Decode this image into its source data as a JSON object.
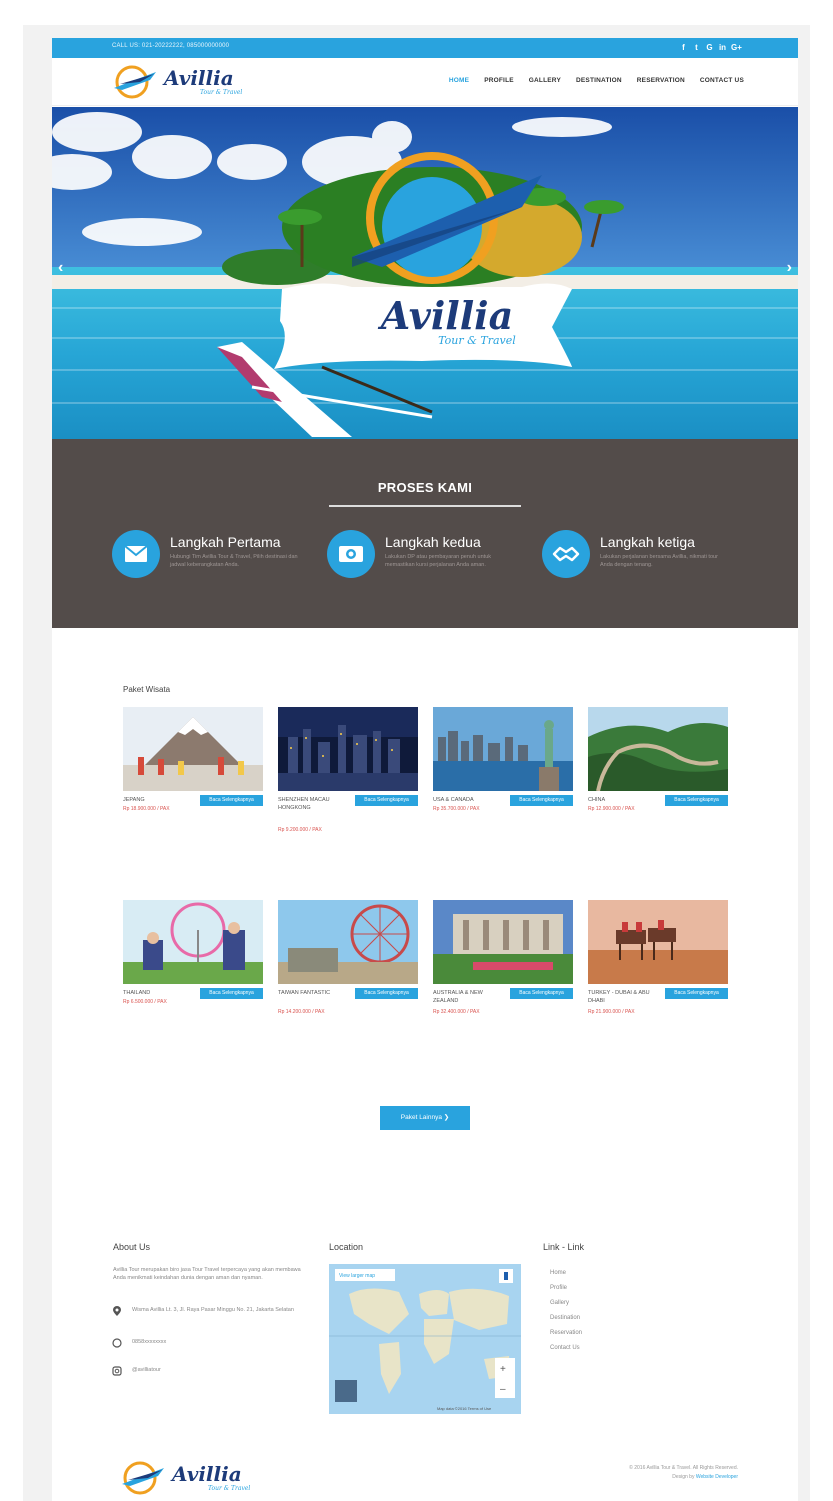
{
  "topbar": {
    "phone": "CALL US: 021-20222222, 085000000000",
    "social": [
      "f",
      "t",
      "G",
      "in",
      "G+"
    ]
  },
  "brand": {
    "name": "Avillia",
    "tagline": "Tour & Travel"
  },
  "nav": [
    "HOME",
    "PROFILE",
    "GALLERY",
    "DESTINATION",
    "RESERVATION",
    "CONTACT US"
  ],
  "hero": {
    "prev": "‹",
    "next": "›"
  },
  "process": {
    "title": "PROSES KAMI",
    "steps": [
      {
        "title": "Langkah Pertama",
        "desc": "Hubungi Tim Avillia Tour & Travel, Pilih destinasi dan jadwal keberangkatan Anda."
      },
      {
        "title": "Langkah kedua",
        "desc": "Lakukan DP atau pembayaran penuh untuk memastikan kursi perjalanan Anda aman."
      },
      {
        "title": "Langkah ketiga",
        "desc": "Lakukan perjalanan bersama Avillia, nikmati tour Anda dengan tenang."
      }
    ]
  },
  "paket": {
    "title": "Paket Wisata",
    "button": "Baca Selengkapnya",
    "items": [
      {
        "name": "JEPANG",
        "price": "Rp 18.900.000 / PAX"
      },
      {
        "name": "SHENZHEN MACAU HONGKONG",
        "price": "Rp 9.200.000 / PAX"
      },
      {
        "name": "USA & CANADA",
        "price": "Rp 35.700.000 / PAX"
      },
      {
        "name": "CHINA",
        "price": "Rp 12.900.000 / PAX"
      },
      {
        "name": "THAILAND",
        "price": "Rp 6.500.000 / PAX"
      },
      {
        "name": "TAIWAN FANTASTIC",
        "price": "Rp 14.200.000 / PAX"
      },
      {
        "name": "AUSTRALIA & NEW ZEALAND",
        "price": "Rp 32.400.000 / PAX"
      },
      {
        "name": "TURKEY - DUBAI & ABU DHABI",
        "price": "Rp 21.900.000 / PAX"
      }
    ],
    "more": "Paket Lainnya"
  },
  "footer": {
    "about_title": "About Us",
    "about_text": "Avillia Tour merupakan biro jasa Tour Travel terpercaya yang akan membawa Anda menikmati keindahan dunia dengan aman dan nyaman.",
    "address": "Wisma Avillia Lt. 3, Jl. Raya Pasar Minggu No. 21, Jakarta Selatan",
    "whatsapp": "0858xxxxxxxx",
    "instagram": "@avilliatour",
    "location_title": "Location",
    "map_button": "View larger map",
    "map_credit": "Map data ©2016 Terms of Use",
    "links_title": "Link - Link",
    "links": [
      "Home",
      "Profile",
      "Gallery",
      "Destination",
      "Reservation",
      "Contact Us"
    ],
    "copyright": "© 2016 Avillia Tour & Travel. All Rights Reserved.",
    "designed_prefix": "Design by",
    "designed_by": "Website Developer"
  },
  "colors": {
    "accent": "#29a3de",
    "dark": "#534c4a",
    "navy": "#1d3b7a",
    "price": "#d9534f"
  }
}
